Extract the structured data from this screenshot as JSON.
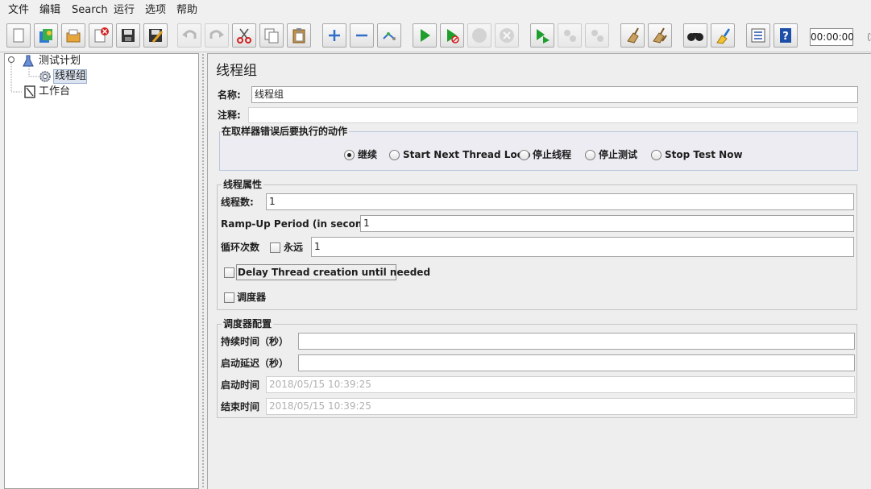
{
  "menu": {
    "file": "文件",
    "edit": "编辑",
    "search": "Search",
    "run": "运行",
    "options": "选项",
    "help": "帮助"
  },
  "toolbar": {
    "icons": [
      "new-icon",
      "templates-icon",
      "open-icon",
      "close-icon",
      "save-icon",
      "save-as-icon",
      "undo-icon",
      "redo-icon",
      "cut-icon",
      "copy-icon",
      "paste-icon",
      "expand-icon",
      "collapse-icon",
      "toggle-icon",
      "start-icon",
      "start-no-pauses-icon",
      "stop-icon",
      "shutdown-icon",
      "remote-start-icon",
      "remote-stop-icon",
      "remote-shutdown-icon",
      "clear-icon",
      "clear-all-icon",
      "search-icon",
      "reset-search-icon",
      "function-helper-icon",
      "help-icon"
    ],
    "timer": "00:00:00"
  },
  "tree": {
    "root": "测试计划",
    "thread_group": "线程组",
    "workbench": "工作台"
  },
  "panel": {
    "title": "线程组",
    "name_label": "名称:",
    "name_value": "线程组",
    "comment_label": "注释:",
    "comment_value": ""
  },
  "error_action": {
    "legend": "在取样器错误后要执行的动作",
    "options": [
      "继续",
      "Start Next Thread Loop",
      "停止线程",
      "停止测试",
      "Stop Test Now"
    ],
    "selected": "继续"
  },
  "thread_props": {
    "legend": "线程属性",
    "num_threads_label": "线程数:",
    "num_threads": "1",
    "rampup_label": "Ramp-Up Period (in seconds):",
    "rampup": "1",
    "loop_label": "循环次数",
    "forever_label": "永远",
    "loop_count": "1",
    "delay_label": "Delay Thread creation until needed",
    "scheduler_label": "调度器"
  },
  "scheduler": {
    "legend": "调度器配置",
    "duration_label": "持续时间（秒）",
    "duration": "",
    "delay_label": "启动延迟（秒）",
    "delay": "",
    "start_label": "启动时间",
    "start": "2018/05/15 10:39:25",
    "end_label": "结束时间",
    "end": "2018/05/15 10:39:25"
  }
}
